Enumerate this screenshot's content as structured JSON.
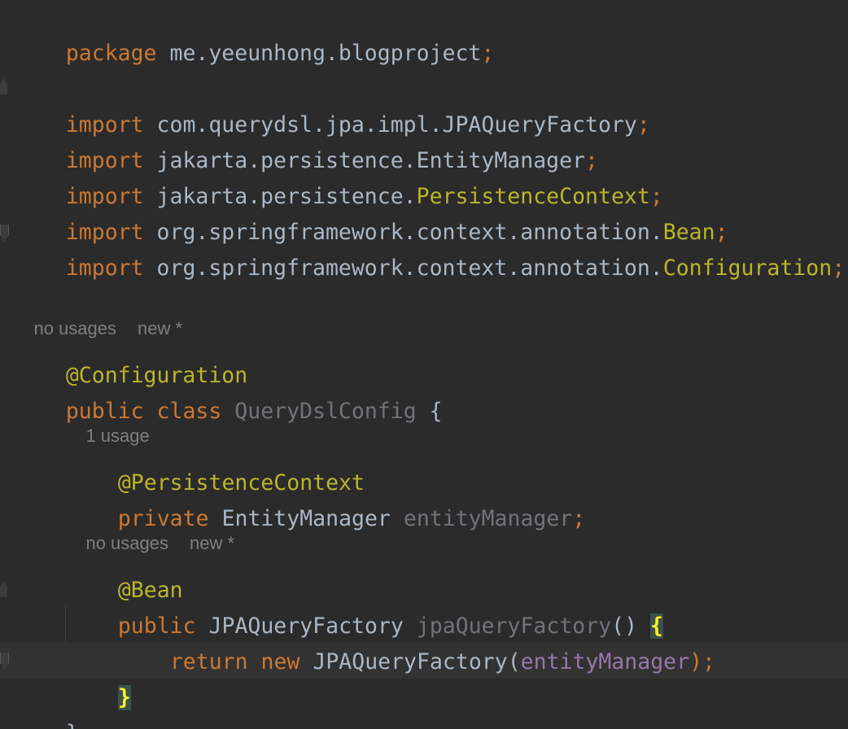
{
  "code": {
    "package_kw": "package",
    "package_name": "me.yeeunhong.blogproject",
    "semicolon": ";",
    "imports": [
      {
        "kw": "import",
        "path": "com.querydsl.jpa.impl.JPAQueryFactory",
        "highlight": ""
      },
      {
        "kw": "import",
        "path": "jakarta.persistence.EntityManager",
        "highlight": ""
      },
      {
        "kw": "import",
        "path": "jakarta.persistence.",
        "highlight": "PersistenceContext"
      },
      {
        "kw": "import",
        "path": "org.springframework.context.annotation.",
        "highlight": "Bean"
      },
      {
        "kw": "import",
        "path": "org.springframework.context.annotation.",
        "highlight": "Configuration"
      }
    ],
    "class_hint": {
      "usages": "no usages",
      "author": "new *"
    },
    "class_annotation": "@Configuration",
    "class_decl": {
      "public_kw": "public",
      "class_kw": "class",
      "name": "QueryDslConfig",
      "open_brace": "{"
    },
    "field_hint": {
      "usages": "1 usage"
    },
    "field_annotation": "@PersistenceContext",
    "field_decl": {
      "private_kw": "private",
      "type": "EntityManager",
      "name": "entityManager"
    },
    "method_hint": {
      "usages": "no usages",
      "author": "new *"
    },
    "method_annotation": "@Bean",
    "method_decl": {
      "public_kw": "public",
      "return_type": "JPAQueryFactory",
      "name": "jpaQueryFactory",
      "parens": "()",
      "open_brace": "{"
    },
    "return_stmt": {
      "return_kw": "return",
      "new_kw": "new",
      "ctor": "JPAQueryFactory",
      "open_paren": "(",
      "arg": "entityManager",
      "close": ");"
    },
    "method_close": "}",
    "class_close": "}"
  },
  "colors": {
    "background": "#2b2b2b",
    "keyword": "#cc7832",
    "annotation": "#bbb529",
    "default_text": "#a9b7c6",
    "unused": "#72737a",
    "field": "#9876aa",
    "inlay_hint": "#7f7f7f",
    "brace_match": "#ffef28"
  }
}
